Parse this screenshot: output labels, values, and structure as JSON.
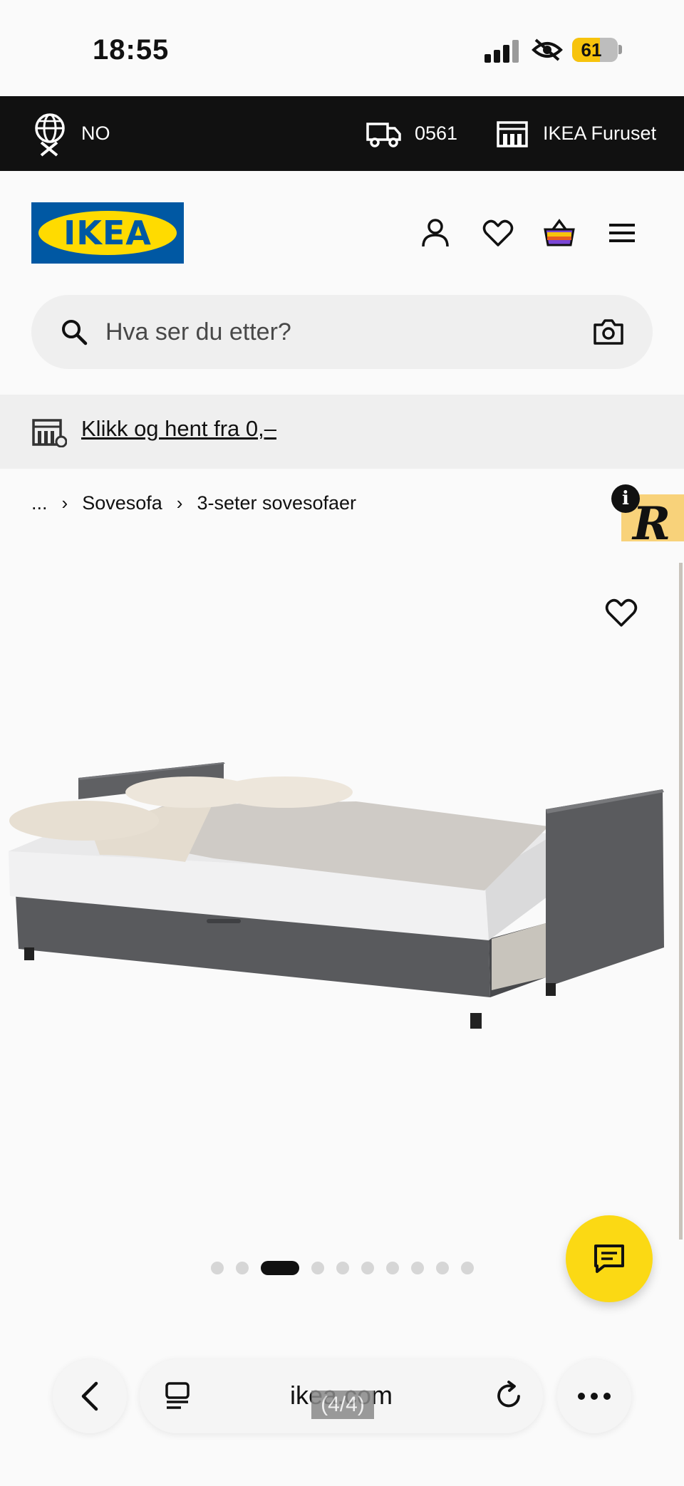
{
  "status_bar": {
    "time": "18:55",
    "battery": "61",
    "battery_level": 0.61
  },
  "top_bar": {
    "language": "NO",
    "postal_code": "0561",
    "store": "IKEA Furuset"
  },
  "header": {
    "logo_text": "IKEA"
  },
  "search": {
    "placeholder": "Hva ser du etter?"
  },
  "promo": {
    "text": "Klikk og hent fra 0,–"
  },
  "breadcrumb": {
    "ellipsis": "...",
    "items": [
      "Sovesofa",
      "3-seter sovesofaer"
    ]
  },
  "badge": {
    "letter": "R",
    "info": "i"
  },
  "gallery": {
    "dot_count": 10,
    "active_index": 2
  },
  "browser": {
    "url": "ikea.com",
    "page_counter": "(4/4)"
  },
  "colors": {
    "ikea_blue": "#0058a3",
    "ikea_yellow": "#ffdb00",
    "chat_yellow": "#fbd914",
    "top_bar": "#111111"
  }
}
